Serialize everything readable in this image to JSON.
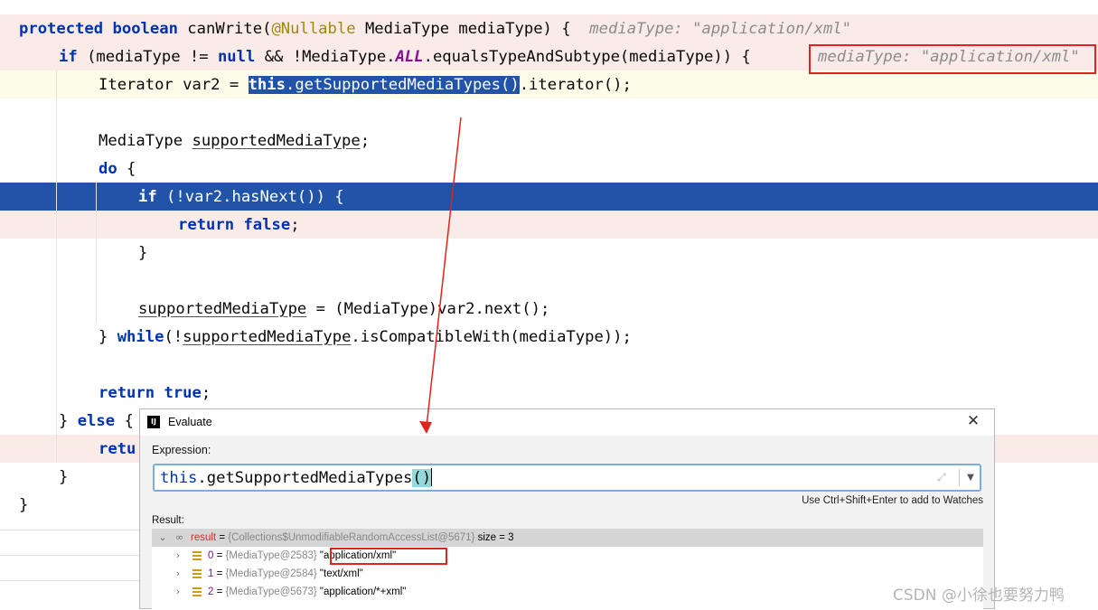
{
  "code": {
    "signature": {
      "kw1": "protected",
      "kw2": "boolean",
      "method": "canWrite(",
      "annotation": "@Nullable",
      "params": "MediaType mediaType) {",
      "hint": "mediaType: \"application/xml\""
    },
    "if_line": {
      "kw": "if",
      "p1": "(mediaType != ",
      "kw_null": "null",
      "p2": " && !MediaType.",
      "static": "ALL",
      "p3": ".equalsTypeAndSubtype(mediaType)) {",
      "hint": "mediaType: \"application/xml\""
    },
    "iter_line": {
      "p1": "Iterator var2 = ",
      "sel_kw": "this",
      "sel_text": ".getSupportedMediaTypes()",
      "p2": ".iterator();"
    },
    "decl_line": {
      "type": "MediaType ",
      "var": "supportedMediaType",
      "end": ";"
    },
    "do_line": {
      "kw": "do",
      "rest": " {"
    },
    "if2_line": {
      "kw": "if",
      "rest": " (!var2.hasNext()) {"
    },
    "ret_false_line": {
      "kw1": "return",
      "kw2": "false",
      "end": ";"
    },
    "close1": "}",
    "assign_line": {
      "var": "supportedMediaType",
      "rest": " = (MediaType)var2.next();"
    },
    "while_line": {
      "brace": "} ",
      "kw": "while",
      "p1": "(!",
      "var": "supportedMediaType",
      "p2": ".isCompatibleWith(mediaType));"
    },
    "ret_true_line": {
      "kw1": "return",
      "kw2": "true",
      "end": ";"
    },
    "else_line": {
      "brace": "} ",
      "kw": "else",
      "rest": " {"
    },
    "retu_line": "retu",
    "close2": "}",
    "close3": "}"
  },
  "dialog": {
    "app_icon": "IJ",
    "title": "Evaluate",
    "close": "✕",
    "expression_label": "Expression:",
    "expr_kw": "this",
    "expr_text": ".getSupportedMediaTypes",
    "expr_paren": "()",
    "watch_hint": "Use Ctrl+Shift+Enter to add to Watches",
    "result_label": "Result:",
    "result": {
      "name": "result",
      "eq": " = ",
      "type": "{Collections$UnmodifiableRandomAccessList@5671}",
      "size": "  size = 3"
    },
    "items": [
      {
        "index": "0",
        "type": "{MediaType@2583}",
        "value": "\"application/xml\""
      },
      {
        "index": "1",
        "type": "{MediaType@2584}",
        "value": "\"text/xml\""
      },
      {
        "index": "2",
        "type": "{MediaType@5673}",
        "value": "\"application/*+xml\""
      }
    ]
  },
  "watermark": "CSDN @小徐也要努力鸭",
  "colors": {
    "keyword": "#0033b3",
    "annotation": "#9e880d",
    "static_field": "#871094",
    "selection": "#2154a8",
    "breakpoint_line": "#faeae8",
    "current_line": "#fdfce9",
    "highlight_box": "#e0231c"
  }
}
